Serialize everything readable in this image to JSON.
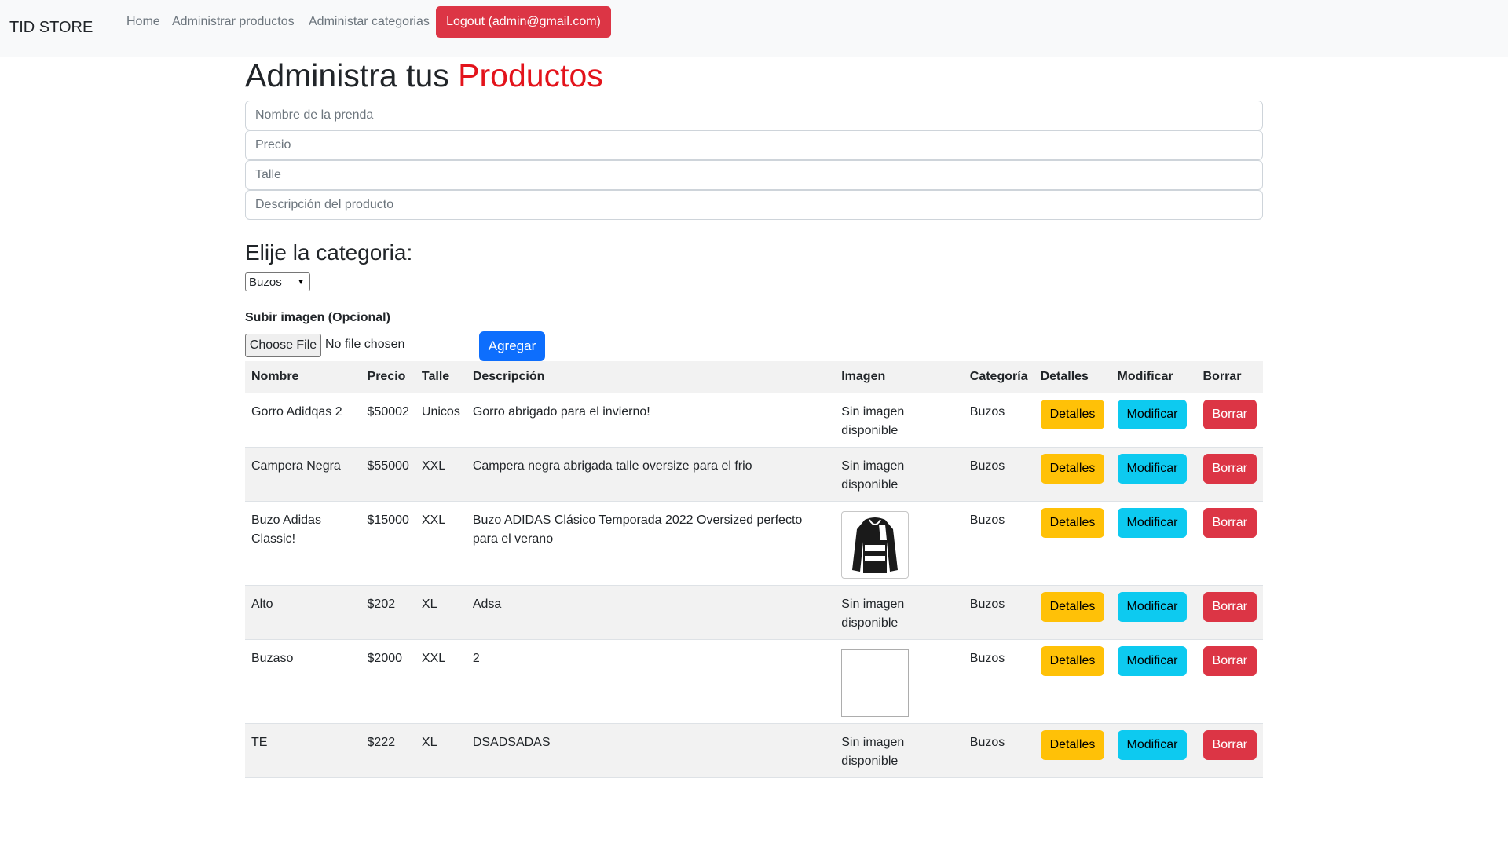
{
  "navbar": {
    "brand": "TID STORE",
    "links": [
      "Home",
      "Administrar productos",
      "Administar categorias"
    ],
    "logout": "Logout (admin@gmail.com)"
  },
  "title": {
    "prefix": "Administra tus",
    "accent": "Productos",
    "accent_color": "#e3131b"
  },
  "form": {
    "name_placeholder": "Nombre de la prenda",
    "price_placeholder": "Precio",
    "size_placeholder": "Talle",
    "desc_placeholder": "Descripción del producto",
    "category_heading": "Elije la categoria:",
    "category_selected": "Buzos",
    "upload_label": "Subir imagen (Opcional)",
    "choose_file": "Choose File",
    "no_file": "No file chosen",
    "add_button": "Agregar"
  },
  "table": {
    "headers": [
      "Nombre",
      "Precio",
      "Talle",
      "Descripción",
      "Imagen",
      "Categoría",
      "Detalles",
      "Modificar",
      "Borrar"
    ],
    "button_labels": {
      "details": "Detalles",
      "modify": "Modificar",
      "delete": "Borrar"
    },
    "no_image_text": "Sin imagen disponible",
    "rows": [
      {
        "name": "Gorro Adidqas 2",
        "price": "$50002",
        "size": "Unicos",
        "description": "Gorro abrigado para el invierno!",
        "image": "Sin imagen disponible",
        "category": "Buzos"
      },
      {
        "name": "Campera Negra",
        "price": "$55000",
        "size": "XXL",
        "description": "Campera negra abrigada talle oversize para el frio",
        "image": "Sin imagen disponible",
        "category": "Buzos"
      },
      {
        "name": "Buzo Adidas Classic!",
        "price": "$15000",
        "size": "XXL",
        "description": "Buzo ADIDAS Clásico Temporada 2022 Oversized perfecto para el verano",
        "image": "jacket-photo",
        "category": "Buzos"
      },
      {
        "name": "Alto",
        "price": "$202",
        "size": "XL",
        "description": "Adsa",
        "image": "Sin imagen disponible",
        "category": "Buzos"
      },
      {
        "name": "Buzaso",
        "price": "$2000",
        "size": "XXL",
        "description": "2",
        "image": "broken-image",
        "category": "Buzos"
      },
      {
        "name": "TE",
        "price": "$222",
        "size": "XL",
        "description": "DSADSADAS",
        "image": "Sin imagen disponible",
        "category": "Buzos"
      }
    ]
  },
  "colors": {
    "danger": "#dc3545",
    "primary": "#0d6efd",
    "warning": "#ffc107",
    "info": "#0dcaf0"
  }
}
